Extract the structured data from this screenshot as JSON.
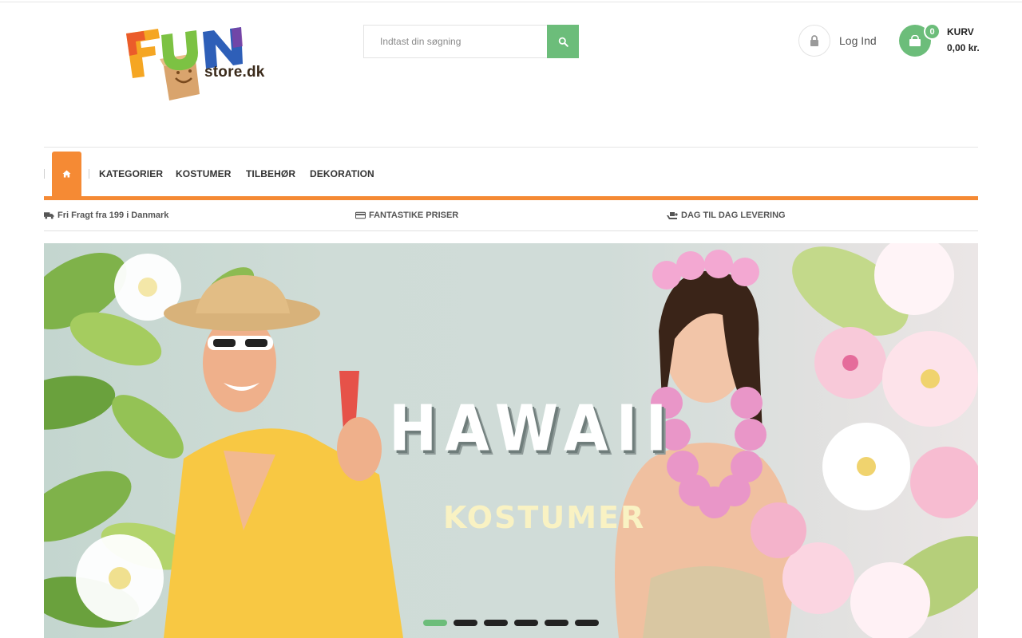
{
  "header": {
    "logo_text": "store.dk",
    "search_placeholder": "Indtast din søgning",
    "login_label": "Log Ind",
    "cart": {
      "count": "0",
      "label": "KURV",
      "total": "0,00 kr."
    }
  },
  "nav": {
    "items": [
      {
        "label": "KATEGORIER"
      },
      {
        "label": "KOSTUMER"
      },
      {
        "label": "TILBEHØR"
      },
      {
        "label": "DEKORATION"
      }
    ]
  },
  "usp": [
    {
      "label": "Fri Fragt fra 199 i Danmark",
      "icon": "truck-icon"
    },
    {
      "label": "FANTASTIKE PRISER",
      "icon": "credit-card-icon"
    },
    {
      "label": "DAG TIL DAG LEVERING",
      "icon": "delivery-icon"
    }
  ],
  "banner": {
    "title": "HAWAII",
    "subtitle": "KOSTUMER",
    "slide_count": 6,
    "active_slide": 1
  },
  "colors": {
    "accent_orange": "#f58a34",
    "accent_green": "#6cbd7a"
  }
}
